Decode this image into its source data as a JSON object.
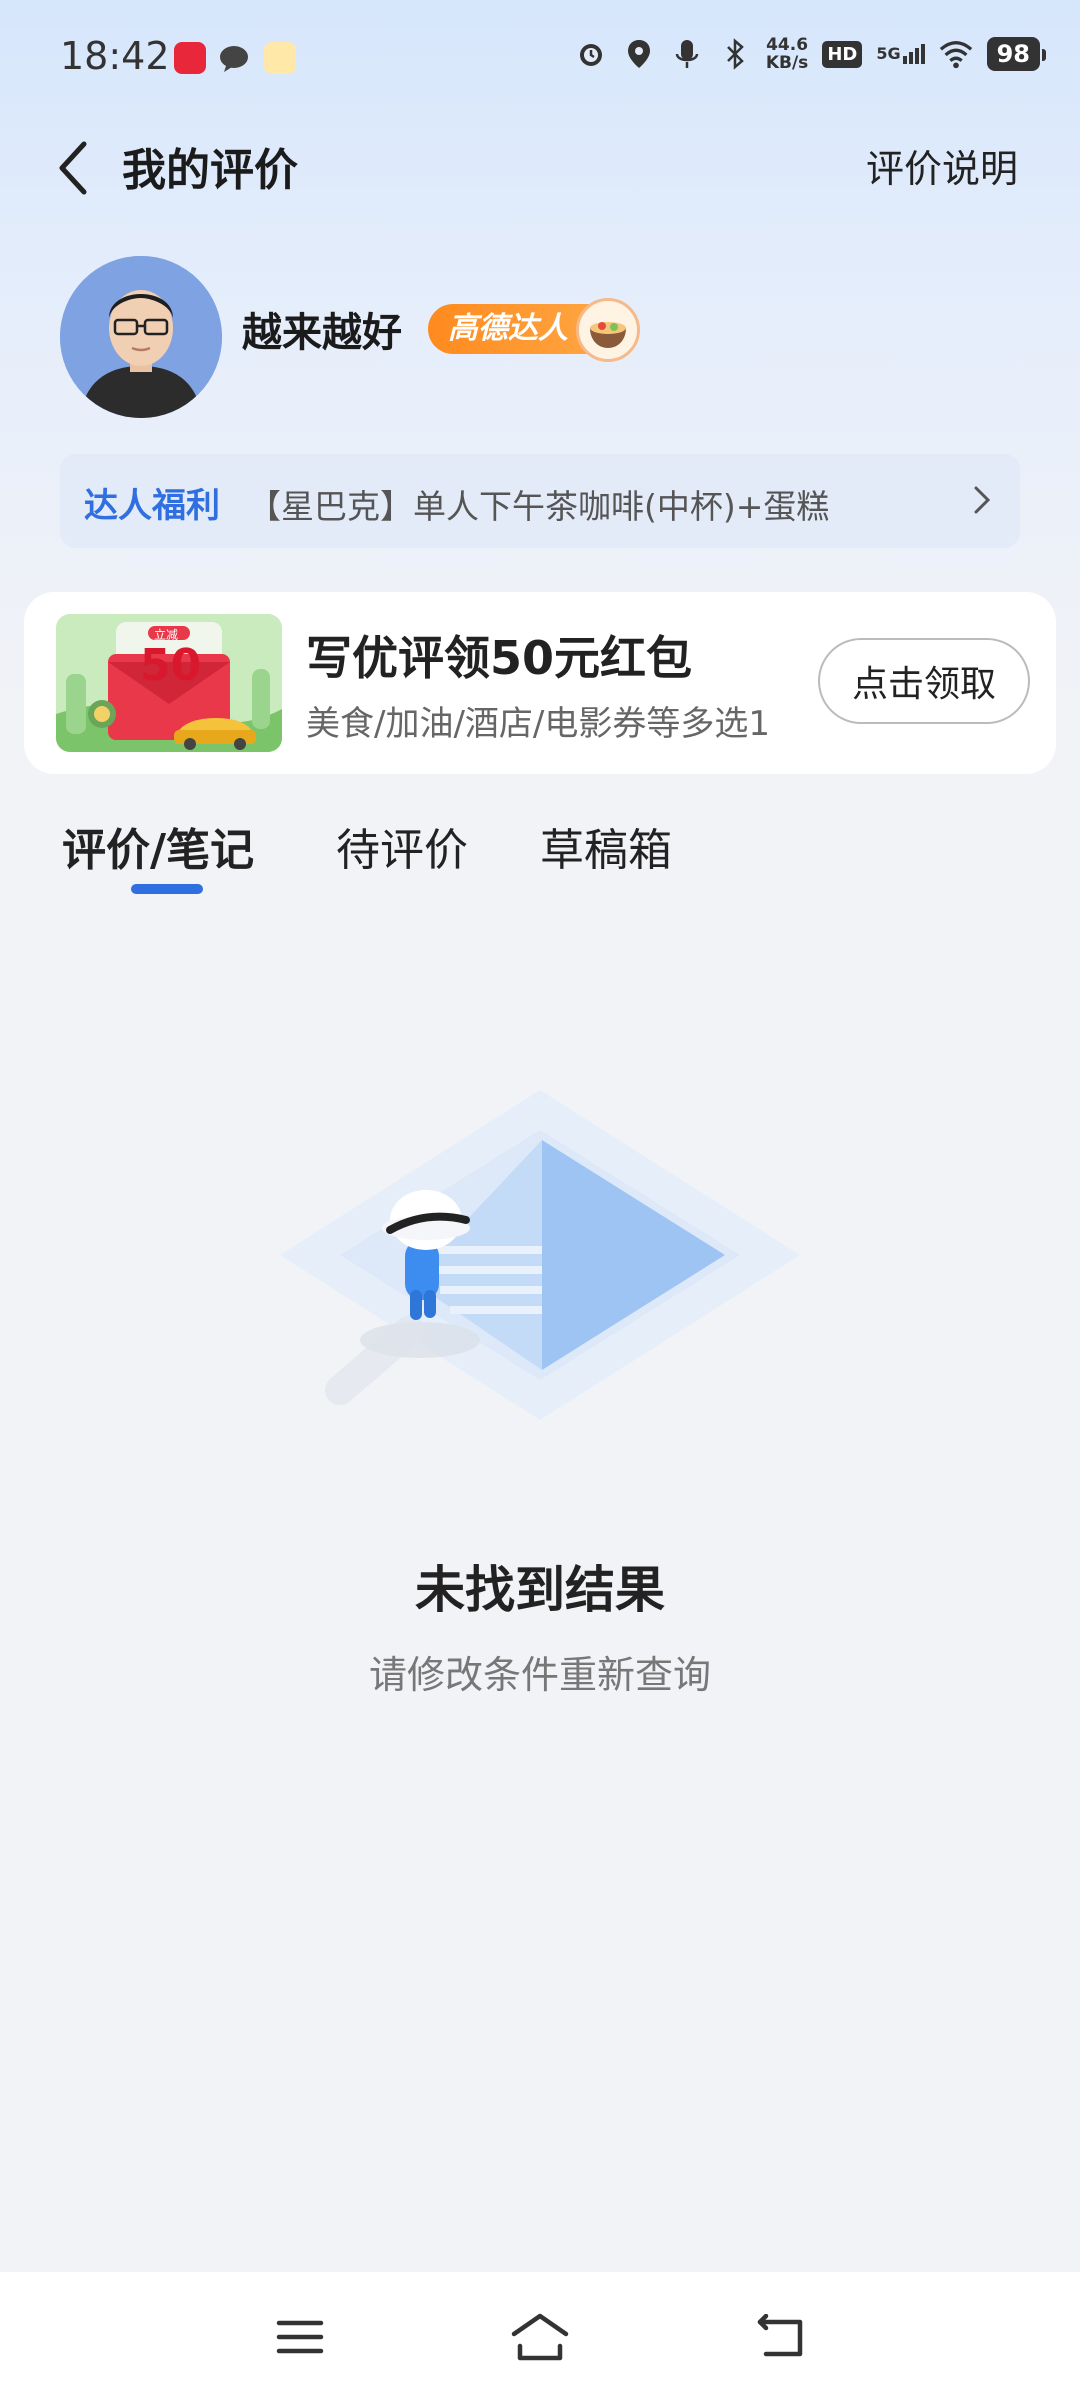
{
  "status_bar": {
    "time": "18:42",
    "net_speed_value": "44.6",
    "net_speed_unit": "KB/s",
    "hd_label": "HD",
    "signal_label": "5G",
    "battery": "98"
  },
  "header": {
    "title": "我的评价",
    "explain_link": "评价说明"
  },
  "profile": {
    "username": "越来越好",
    "badge": "高德达人"
  },
  "perk": {
    "tag": "达人福利",
    "text": "【星巴克】单人下午茶咖啡(中杯)+蛋糕"
  },
  "promo": {
    "img_tag": "立减",
    "img_amount": "50",
    "title": "写优评领50元红包",
    "subtitle": "美食/加油/酒店/电影券等多选1",
    "button": "点击领取"
  },
  "tabs": [
    {
      "label": "评价/笔记",
      "active": true
    },
    {
      "label": "待评价",
      "active": false
    },
    {
      "label": "草稿箱",
      "active": false
    }
  ],
  "empty_state": {
    "title": "未找到结果",
    "subtitle": "请修改条件重新查询"
  },
  "colors": {
    "accent": "#2f6fe0",
    "badge": "#ff8a1e",
    "background": "#f2f3f7"
  },
  "icons": {
    "back": "chevron-left-icon",
    "perk_arrow": "chevron-right-icon",
    "nav_menu": "menu-icon",
    "nav_home": "home-icon",
    "nav_back": "return-icon"
  }
}
